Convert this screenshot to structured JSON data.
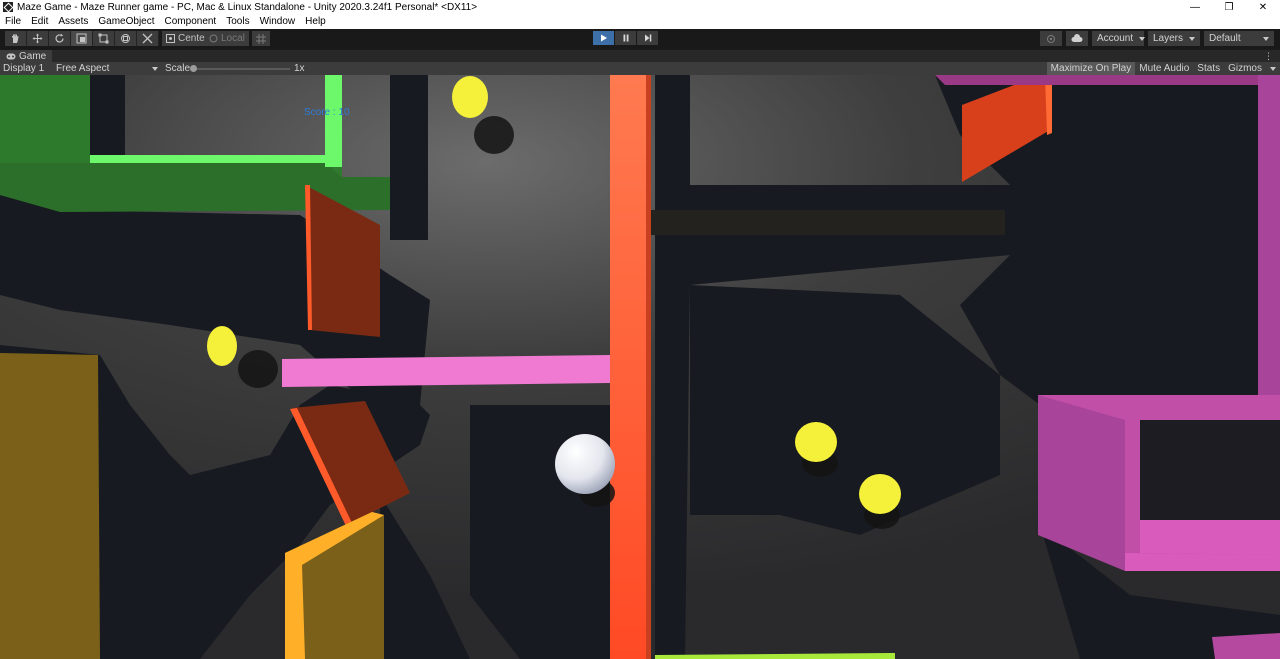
{
  "window": {
    "title": "Maze Game - Maze Runner game - PC, Mac & Linux Standalone - Unity 2020.3.24f1 Personal* <DX11>",
    "controls": {
      "minimize": "—",
      "maximize": "❐",
      "close": "✕"
    }
  },
  "menu": {
    "items": [
      "File",
      "Edit",
      "Assets",
      "GameObject",
      "Component",
      "Tools",
      "Window",
      "Help"
    ]
  },
  "toolbar": {
    "pivot_label": "Center",
    "space_label": "Local",
    "account_label": "Account",
    "layers_label": "Layers",
    "layout_label": "Default"
  },
  "game_tab": {
    "label": "Game"
  },
  "game_bar": {
    "display": "Display 1",
    "aspect": "Free Aspect",
    "scale_label": "Scale",
    "scale_value": "1x",
    "maximize_on_play": "Maximize On Play",
    "mute_audio": "Mute Audio",
    "stats": "Stats",
    "gizmos": "Gizmos"
  },
  "game": {
    "score_text": "Score : 10"
  },
  "colors": {
    "play_active": "#3d6fa8",
    "score_text": "#2f7dd8",
    "coin": "#f5f03a",
    "orange_wall": "#ff5a30",
    "pink_wall": "#f07ad2",
    "magenta_wall": "#c14fa8",
    "green_wall": "#6cf86a",
    "olive_wall": "#7a6018"
  }
}
